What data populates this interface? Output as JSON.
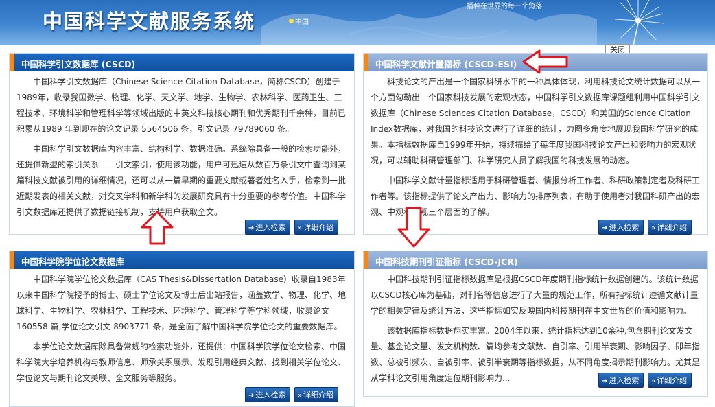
{
  "header": {
    "title": "中国科学文献服务系统",
    "country": "中国",
    "slogan": "播种在世界的每一个角落"
  },
  "tooltip": {
    "close_label": "关闭"
  },
  "panels": {
    "cscd": {
      "title": "中国科学引文数据库 (CSCD)",
      "paragraphs": [
        "中国科学引文数据库（Chinese Science Citation Database，简称CSCD）创建于1989年，收录我国数学、物理、化学、天文学、地学、生物学、农林科学、医药卫生、工程技术、环境科学和管理科学等领域出版的中英文科技核心期刊和优秀期刊千余种，目前已积累从1989 年到现在的论文记录 5564506 条，引文记录 79789060 条。",
        "中国科学引文数据库内容丰富、结构科学、数据准确。系统除具备一般的检索功能外，还提供新型的索引关系——引文索引，使用该功能，用户可迅速从数百万条引文中查询到某篇科技文献被引用的详细情况，还可以从一篇早期的重要文献或著者姓名入手，检索到一批近期发表的相关文献，对交叉学科和新学科的发展研究具有十分重要的参考价值。中国科学引文数据库还提供了数据链接机制，支持用户获取全文。"
      ],
      "enter_label": "进入检索",
      "detail_label": "详细介绍"
    },
    "esi": {
      "title": "中国科学文献计量指标 (CSCD-ESI)",
      "paragraphs": [
        "科技论文的产出是一个国家科研水平的一种具体体现，利用科技论文统计数据可以从一个方面勾勒出一个国家科技发展的宏观状态，中国科学引文数据库课题组利用中国科学引文数据库（Chinese Sciences Citation Database，CSCD）和美国的Science Citation Index数据库，对我国的科技论文进行了详细的统计，力图多角度地展现我国科学研究的成果。本指标数据库自1999年开始，持续描绘了每年度我国科技论文产出和影响力的宏观状况，可以辅助科研管理部门、科学研究人员了解我国的科技发展的动态。",
        "中国科学文献计量指标适用于科研管理者、情报分析工作者、科研政策制定者及科研工作者等。该指标提供了论文产出力、影响力的排序列表，有助于使用者对我国科研产出的宏观、中观和微观三个层面的了解。"
      ],
      "enter_label": "进入检索",
      "detail_label": "详细介绍"
    },
    "thesis": {
      "title": "中国科学院学位论文数据库",
      "paragraphs": [
        "中国科学院学位论文数据库（CAS Thesis&Dissertation Database）收录自1983年以来中国科学院授予的博士、硕士学位论文及博士后出站报告，涵盖数学、物理、化学、地球科学、生物科学、农林科学、工程技术、环境科学、管理科学等学科领域，收录论文 160558 篇,学位论文引文 8903771 条，是全面了解中国科学院学位论文的重要数据库。",
        "本学位论文数据库除具备常规的检索功能外，还提供：中国科学院学位论文检索、中国科学院大学培养机构与教师信息、师承关系展示、发现引用经典文献、找到相关学位论文、学位论文与期刊论文关联、全文服务等服务。"
      ],
      "enter_label": "进入检索",
      "detail_label": "详细介绍"
    },
    "jcr": {
      "title": "中国科技期刊引证指标 (CSCD-JCR)",
      "paragraphs": [
        "中国科技期刊引证指标数据库是根据CSCD年度期刊指标统计数据创建的。该统计数据以CSCD核心库为基础，对刊名等信息进行了大量的规范工作，所有指标统计遵循文献计量学的相关定律及统计方法，这些指标如实反映国内科技期刊在中文世界的价值和影响力。",
        "该数据库指标数据翔实丰富。2004年以来，统计指标达到10余种,包含期刊论文发文量、基金论文量、发文机构数、篇均参考文献数、自引率、引用半衰期、影响因子、即年指数、总被引频次、自被引率、被引半衰期等指标数据，从不同角度揭示期刊影响力。尤其是从学科论文引用角度定位期刊影响力..."
      ],
      "enter_label": "进入检索",
      "detail_label": "详细介绍"
    }
  },
  "colors": {
    "arrow": "#e0171e",
    "head_dark": "#0f4f9e",
    "head_accent": "#f08a1c"
  }
}
